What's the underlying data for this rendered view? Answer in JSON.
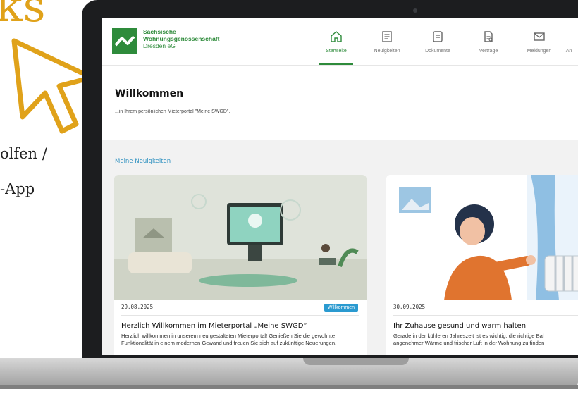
{
  "promo": {
    "title_fragment": "ks",
    "line1": "olfen /",
    "line2": "-App"
  },
  "app": {
    "brand_line1": "Sächsische",
    "brand_line2": "Wohnungsgenossenschaft",
    "brand_line3": "Dresden eG",
    "nav": [
      {
        "label": "Startseite",
        "icon": "home-icon",
        "active": true
      },
      {
        "label": "Neuigkeiten",
        "icon": "newspaper-icon",
        "active": false
      },
      {
        "label": "Dokumente",
        "icon": "document-icon",
        "active": false
      },
      {
        "label": "Verträge",
        "icon": "contract-icon",
        "active": false
      },
      {
        "label": "Meldungen",
        "icon": "mail-icon",
        "active": false
      },
      {
        "label": "An",
        "icon": "more-icon",
        "active": false
      }
    ]
  },
  "welcome": {
    "title": "Willkommen",
    "subtitle": "...in Ihrem persönlichen Mieterportal \"Meine SWGD\"."
  },
  "news": {
    "section_title": "Meine Neuigkeiten",
    "cards": [
      {
        "date": "29.08.2025",
        "badge": "Willkommen",
        "title": "Herzlich Willkommen im Mieterportal „Meine SWGD“",
        "teaser": "Herzlich willkommen in unserem neu gestalteten Mieterportal! Genießen Sie die gewohnte Funktionalität in einem modernen Gewand und freuen Sie sich auf zukünftige Neuerungen."
      },
      {
        "date": "30.09.2025",
        "badge": "",
        "title": "Ihr Zuhause gesund und warm halten",
        "teaser_line1": "Gerade in der kühleren Jahreszeit ist es wichtig, die richtige Bal",
        "teaser_line2": "angenehmer Wärme und frischer Luft in der Wohnung zu finden"
      }
    ]
  },
  "colors": {
    "accent_gold": "#e0a21a",
    "brand_green": "#2e8b3b",
    "link_blue": "#2a8fbf"
  }
}
